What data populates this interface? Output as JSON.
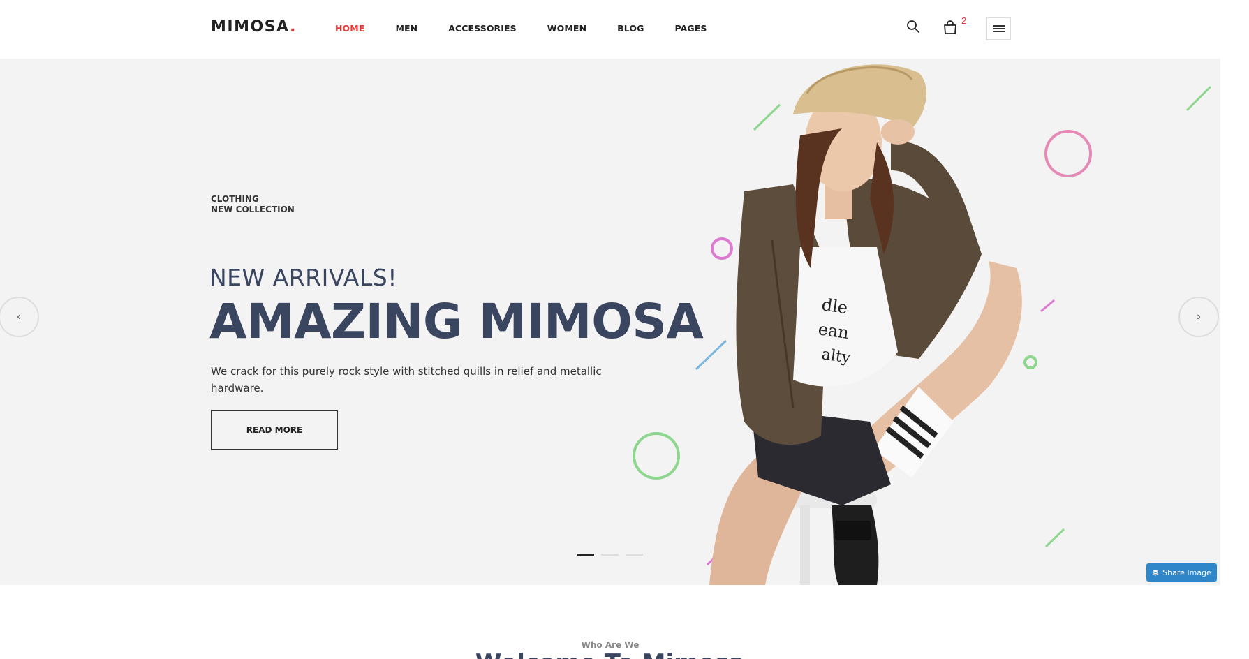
{
  "header": {
    "logo": "MIMOSA",
    "logo_dot": ".",
    "nav": [
      {
        "label": "HOME",
        "active": true
      },
      {
        "label": "MEN"
      },
      {
        "label": "ACCESSORIES"
      },
      {
        "label": "WOMEN"
      },
      {
        "label": "BLOG"
      },
      {
        "label": "PAGES"
      }
    ],
    "cart_count": "2",
    "icons": [
      "search-icon",
      "cart-icon",
      "hamburger-menu-icon"
    ]
  },
  "hero": {
    "tagline_line1": "CLOTHING",
    "tagline_line2": "NEW COLLECTION",
    "subtitle": "NEW ARRIVALS!",
    "title": "AMAZING MIMOSA",
    "description": "We crack for this purely rock style with stitched quills in relief and metallic hardware.",
    "button": "READ MORE",
    "prev_arrow": "‹",
    "next_arrow": "›",
    "slides": 3,
    "active_slide": 1
  },
  "share": {
    "label": "Share Image"
  },
  "about": {
    "kicker": "Who Are We",
    "heading": "Welcome To Mimosa"
  },
  "colors": {
    "accent": "#e53935",
    "heading": "#3a4560",
    "hero_bg": "#f3f3f3",
    "share": "#2f86c8"
  }
}
